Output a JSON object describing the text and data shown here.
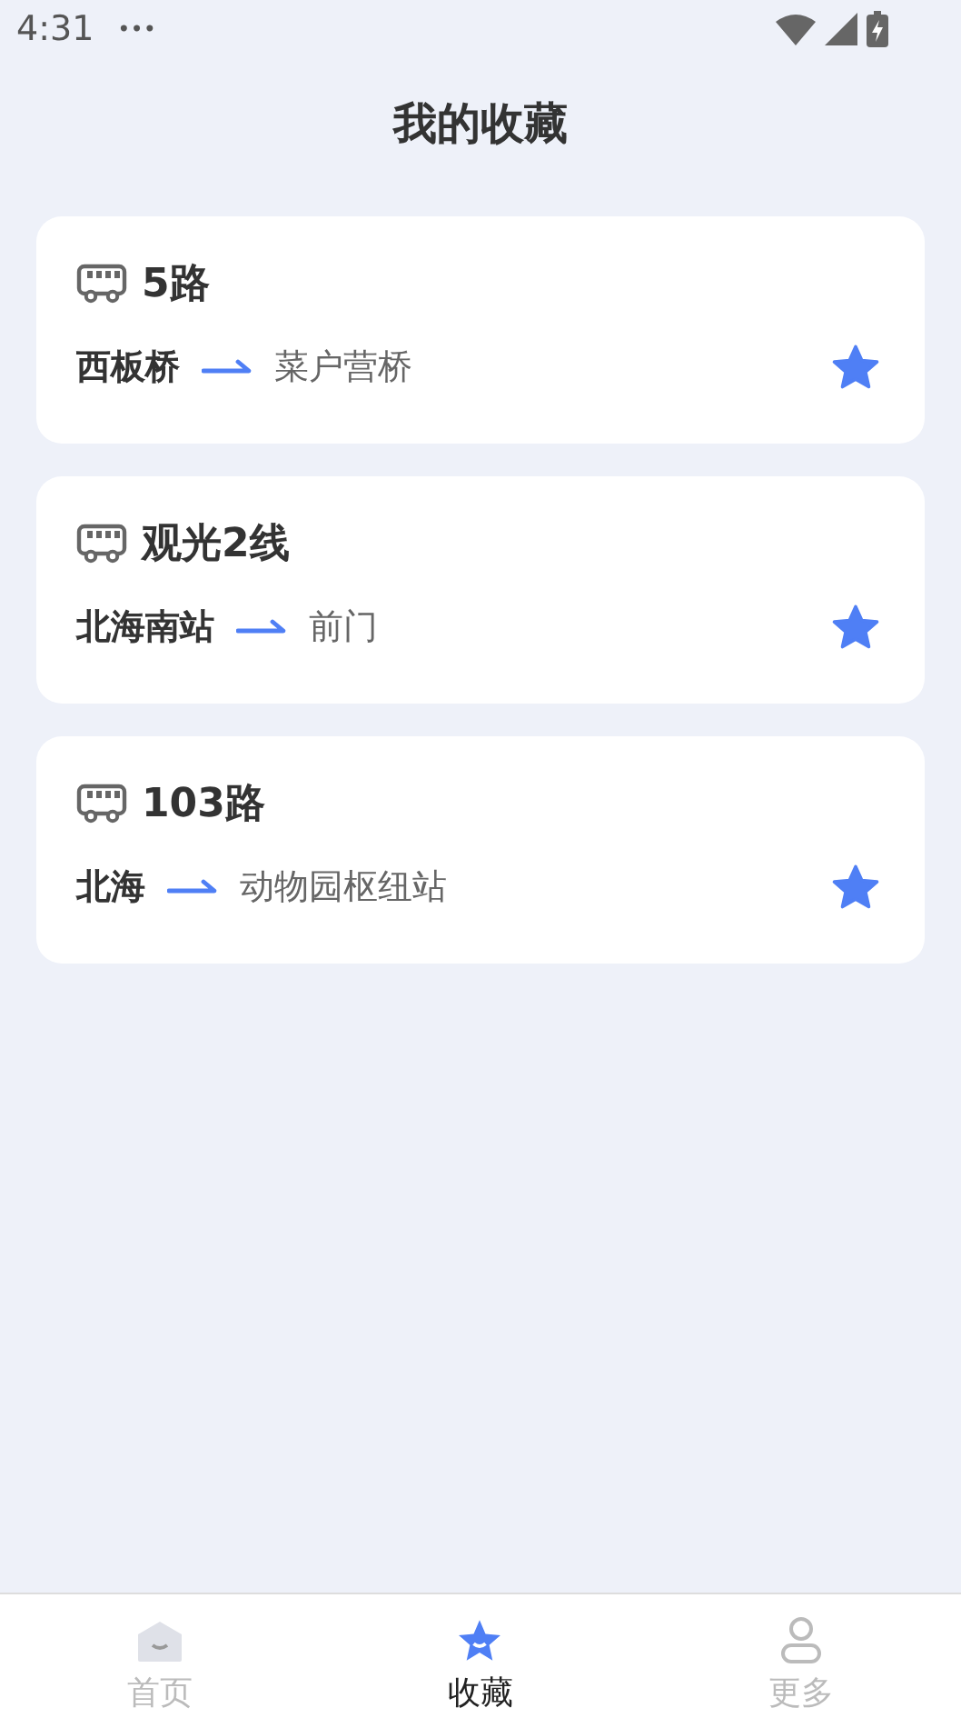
{
  "status_bar": {
    "time": "4:31",
    "more": "•••"
  },
  "header": {
    "title": "我的收藏"
  },
  "favorites": [
    {
      "route": "5路",
      "from": "西板桥",
      "to": "菜户营桥",
      "favorited": true
    },
    {
      "route": "观光2线",
      "from": "北海南站",
      "to": "前门",
      "favorited": true
    },
    {
      "route": "103路",
      "from": "北海",
      "to": "动物园枢纽站",
      "favorited": true
    }
  ],
  "tab_bar": [
    {
      "kind": "home",
      "label": "首页",
      "selected": false
    },
    {
      "kind": "star",
      "label": "收藏",
      "selected": true
    },
    {
      "kind": "person",
      "label": "更多",
      "selected": false
    }
  ]
}
